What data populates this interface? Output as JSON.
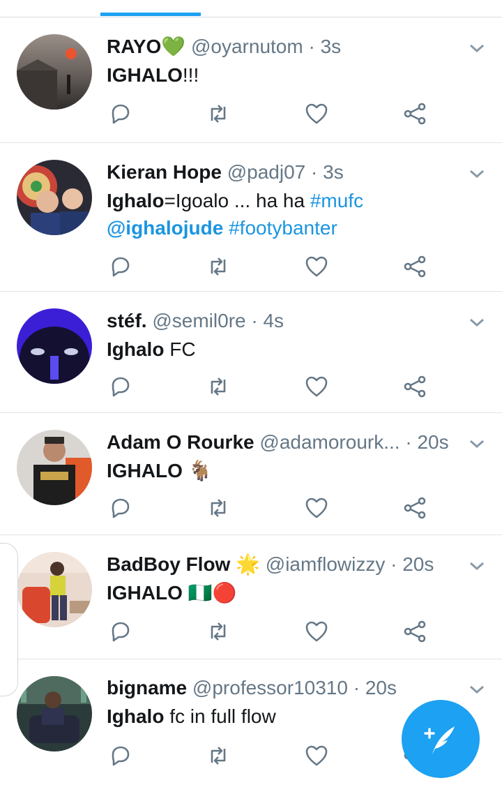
{
  "tweets": [
    {
      "name": "RAYO",
      "name_emoji": "💚",
      "handle": "@oyarnutom",
      "time": "3s",
      "body": [
        {
          "t": "IGHALO",
          "s": "b"
        },
        {
          "t": "!!!",
          "s": ""
        }
      ]
    },
    {
      "name": "Kieran Hope",
      "name_emoji": "",
      "handle": "@padj07",
      "time": "3s",
      "body": [
        {
          "t": "Ighalo",
          "s": "b"
        },
        {
          "t": "=Igoalo ... ha ha ",
          "s": ""
        },
        {
          "t": "#mufc",
          "s": "link"
        },
        {
          "t": "\n",
          "s": ""
        },
        {
          "t": "@ighalojude",
          "s": "link-bold"
        },
        {
          "t": " ",
          "s": ""
        },
        {
          "t": "#footybanter",
          "s": "link"
        }
      ]
    },
    {
      "name": "stéf.",
      "name_emoji": "",
      "handle": "@semil0re",
      "time": "4s",
      "body": [
        {
          "t": "Ighalo",
          "s": "b"
        },
        {
          "t": " FC",
          "s": ""
        }
      ]
    },
    {
      "name": "Adam O Rourke",
      "name_emoji": "",
      "handle": "@adamorourk...",
      "time": "20s",
      "body": [
        {
          "t": "IGHALO",
          "s": "b"
        },
        {
          "t": " 🐐",
          "s": ""
        }
      ]
    },
    {
      "name": "BadBoy Flow",
      "name_emoji": "🌟",
      "handle": "@iamflowizzy",
      "time": "20s",
      "body": [
        {
          "t": "IGHALO",
          "s": "b"
        },
        {
          "t": " 🇳🇬🔴",
          "s": ""
        }
      ]
    },
    {
      "name": "bigname",
      "name_emoji": "",
      "handle": "@professor10310",
      "time": "20s",
      "body": [
        {
          "t": "Ighalo",
          "s": "b"
        },
        {
          "t": " fc in full flow",
          "s": ""
        }
      ]
    }
  ],
  "separator": "·",
  "icons": {
    "reply": "reply-icon",
    "retweet": "retweet-icon",
    "like": "heart-icon",
    "share": "share-icon",
    "more": "chevron-down-icon",
    "compose": "compose-tweet-icon"
  },
  "colors": {
    "accent": "#1da1f2",
    "link": "#1b95e0",
    "secondary": "#657786",
    "divider": "#dfe4e8"
  }
}
